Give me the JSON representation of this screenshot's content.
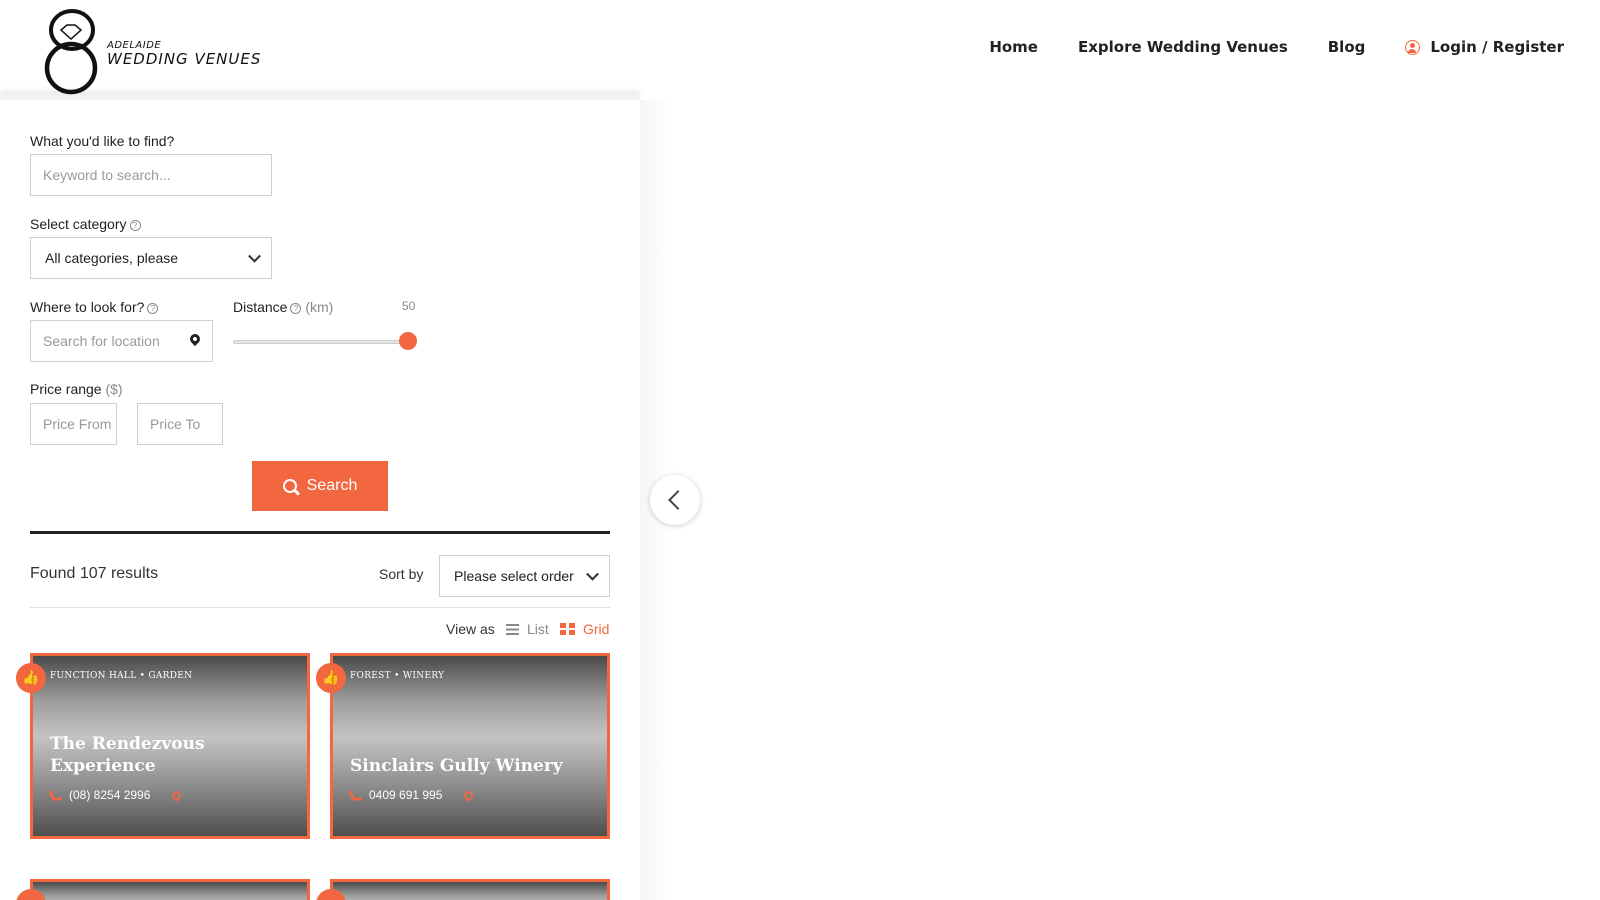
{
  "brand": {
    "line1": "ADELAIDE",
    "line2": "WEDDING VENUES"
  },
  "nav": {
    "home": "Home",
    "explore": "Explore Wedding Venues",
    "blog": "Blog",
    "login": "Login / Register"
  },
  "search": {
    "keyword_label": "What you'd like to find?",
    "keyword_placeholder": "Keyword to search...",
    "category_label": "Select category",
    "category_value": "All categories, please",
    "location_label": "Where to look for?",
    "location_placeholder": "Search for location",
    "distance_label": "Distance",
    "distance_unit": "(km)",
    "distance_value": "50",
    "price_label": "Price range",
    "price_unit": "($)",
    "price_from_placeholder": "Price From",
    "price_to_placeholder": "Price To",
    "button_label": "Search"
  },
  "results": {
    "found_text": "Found 107 results",
    "sort_label": "Sort by",
    "sort_value": "Please select order",
    "view_label": "View as",
    "view_list": "List",
    "view_grid": "Grid"
  },
  "colors": {
    "accent": "#f26640"
  },
  "listings": [
    {
      "categories": "FUNCTION HALL  • GARDEN",
      "title": "The Rendezvous Experience",
      "phone": "(08) 8254 2996"
    },
    {
      "categories": "FOREST  • WINERY",
      "title": "Sinclairs Gully Winery",
      "phone": "0409 691 995"
    }
  ]
}
